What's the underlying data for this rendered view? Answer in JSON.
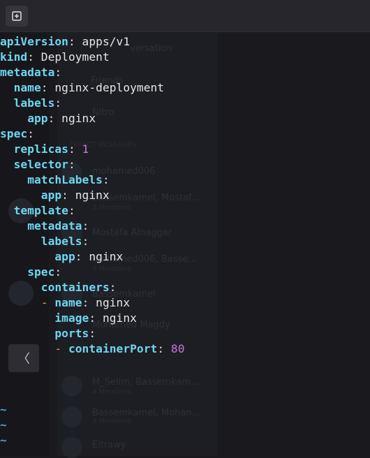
{
  "window": {
    "new_tab_icon": "new-tab-icon"
  },
  "background": {
    "items": [
      "versation",
      "Friends",
      "Nitro",
      "DIRECT MESSAGES",
      "mohamed006",
      "Bassemkamel, Mostaf...",
      "3 Members",
      "Mostafa Alnaggar",
      "mohamed006, Basse...",
      "4 Members",
      "Bassemkamel",
      "Mohamed Magdy",
      "M_Selim, Bassemkam...",
      "4 Members",
      "Bassemkamel, Mohan...",
      "3 Members",
      "Eltrawy"
    ]
  },
  "editor": {
    "lines": [
      {
        "indent": "",
        "key": "apiVersion",
        "value": "apps/v1"
      },
      {
        "indent": "",
        "key": "kind",
        "value": "Deployment"
      },
      {
        "indent": "",
        "key": "metadata",
        "value": ""
      },
      {
        "indent": "  ",
        "key": "name",
        "value": "nginx-deployment"
      },
      {
        "indent": "  ",
        "key": "labels",
        "value": ""
      },
      {
        "indent": "    ",
        "key": "app",
        "value": "nginx"
      },
      {
        "indent": "",
        "key": "spec",
        "value": ""
      },
      {
        "indent": "  ",
        "key": "replicas",
        "value": "1",
        "numeric": true
      },
      {
        "indent": "  ",
        "key": "selector",
        "value": ""
      },
      {
        "indent": "    ",
        "key": "matchLabels",
        "value": ""
      },
      {
        "indent": "      ",
        "key": "app",
        "value": "nginx"
      },
      {
        "indent": "  ",
        "key": "template",
        "value": ""
      },
      {
        "indent": "    ",
        "key": "metadata",
        "value": ""
      },
      {
        "indent": "      ",
        "key": "labels",
        "value": ""
      },
      {
        "indent": "        ",
        "key": "app",
        "value": "nginx"
      },
      {
        "indent": "    ",
        "key": "spec",
        "value": ""
      },
      {
        "indent": "      ",
        "key": "containers",
        "value": ""
      },
      {
        "indent": "      ",
        "dash": true,
        "key": "name",
        "value": "nginx"
      },
      {
        "indent": "        ",
        "key": "image",
        "value": "nginx"
      },
      {
        "indent": "        ",
        "key": "ports",
        "value": ""
      },
      {
        "indent": "        ",
        "dash": true,
        "key": "containerPort",
        "value": "80",
        "numeric": true
      }
    ],
    "empty_line_marker": "~",
    "empty_line_count": 3
  },
  "overlay": {
    "back_label": "〈"
  }
}
